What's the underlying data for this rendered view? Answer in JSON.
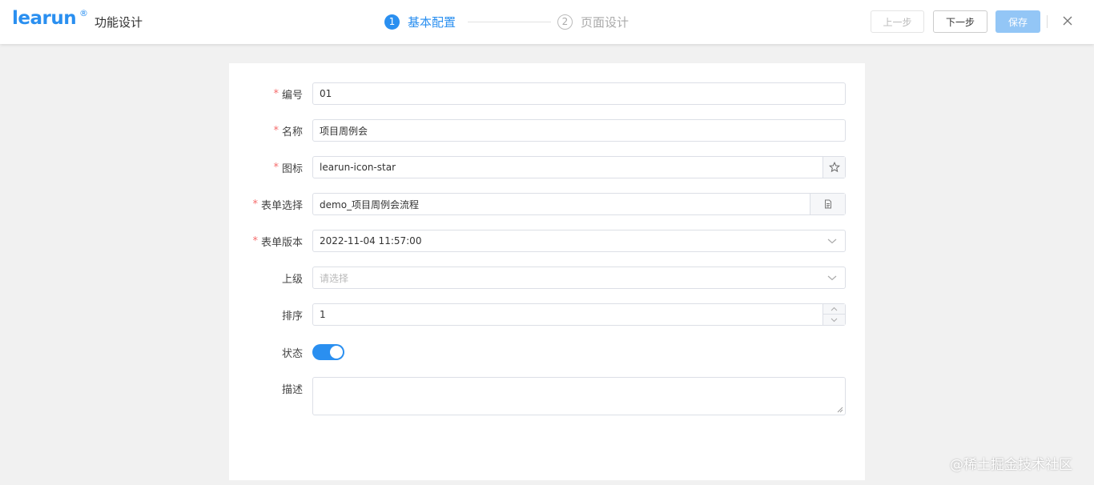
{
  "header": {
    "logo": "learun",
    "logo_mark": "®",
    "page_title": "功能设计",
    "steps": [
      {
        "num": "1",
        "label": "基本配置",
        "state": "active"
      },
      {
        "num": "2",
        "label": "页面设计",
        "state": "idle"
      }
    ],
    "buttons": {
      "prev": "上一步",
      "next": "下一步",
      "save": "保存"
    },
    "close_icon": "close-icon"
  },
  "form": {
    "fields": [
      {
        "label": "编号",
        "required": true,
        "value": "01"
      },
      {
        "label": "名称",
        "required": true,
        "value": "项目周例会"
      },
      {
        "label": "图标",
        "required": true,
        "value": "learun-icon-star",
        "suffix_icon": "star-icon"
      },
      {
        "label": "表单选择",
        "required": true,
        "value": "demo_项目周例会流程",
        "suffix_icon": "document-icon"
      },
      {
        "label": "表单版本",
        "required": true,
        "value": "2022-11-04 11:57:00",
        "suffix_icon": "chevron-down-icon"
      },
      {
        "label": "上级",
        "required": false,
        "value": "",
        "placeholder": "请选择",
        "suffix_icon": "chevron-down-icon"
      },
      {
        "label": "排序",
        "required": false,
        "value": "1"
      },
      {
        "label": "状态",
        "required": false,
        "switch_on": true
      },
      {
        "label": "描述",
        "required": false,
        "value": ""
      }
    ]
  },
  "watermark": "@稀土掘金技术社区",
  "colors": {
    "accent": "#2a8ff0",
    "required": "#f56c6c",
    "save_disabled": "#93c6f6"
  }
}
